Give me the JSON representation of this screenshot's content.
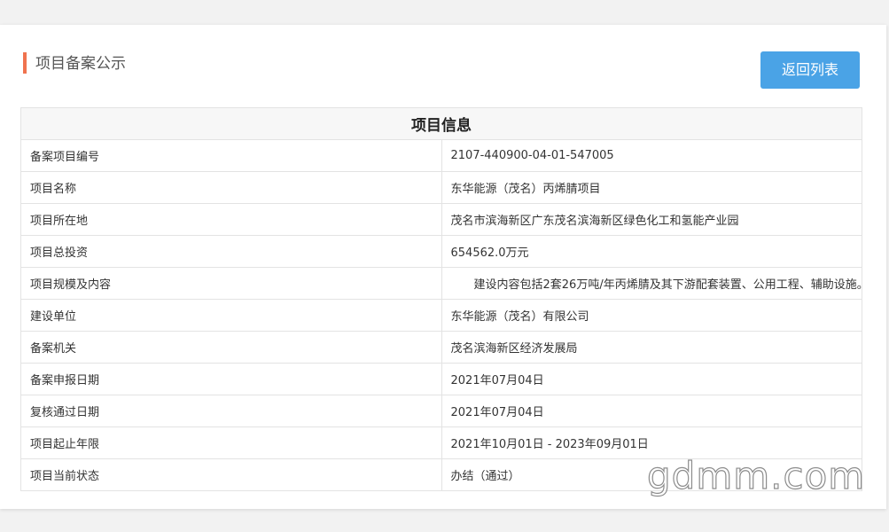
{
  "header": {
    "title": "项目备案公示",
    "back_button_label": "返回列表"
  },
  "table": {
    "title": "项目信息",
    "rows": [
      {
        "label": "备案项目编号",
        "value": "2107-440900-04-01-547005"
      },
      {
        "label": "项目名称",
        "value": "东华能源（茂名）丙烯腈项目"
      },
      {
        "label": "项目所在地",
        "value": "茂名市滨海新区广东茂名滨海新区绿色化工和氢能产业园"
      },
      {
        "label": "项目总投资",
        "value": "654562.0万元"
      },
      {
        "label": "项目规模及内容",
        "value": "　　建设内容包括2套26万吨/年丙烯腈及其下游配套装置、公用工程、辅助设施。"
      },
      {
        "label": "建设单位",
        "value": "东华能源（茂名）有限公司"
      },
      {
        "label": "备案机关",
        "value": "茂名滨海新区经济发展局"
      },
      {
        "label": "备案申报日期",
        "value": "2021年07月04日"
      },
      {
        "label": "复核通过日期",
        "value": "2021年07月04日"
      },
      {
        "label": "项目起止年限",
        "value": "2021年10月01日 - 2023年09月01日"
      },
      {
        "label": "项目当前状态",
        "value": "办结（通过）"
      }
    ]
  },
  "watermark": {
    "text": "gdmm.com"
  },
  "colors": {
    "accent_bar": "#f0734f",
    "button": "#4aa3e6",
    "border": "#e3e3e3",
    "table_header_bg": "#f7f7f7"
  }
}
